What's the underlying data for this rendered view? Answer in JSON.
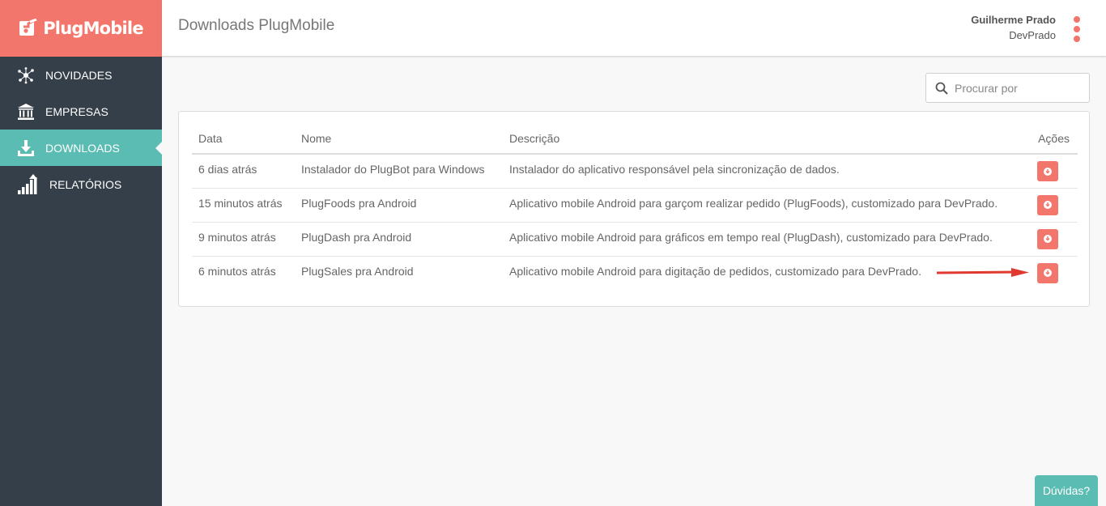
{
  "brand": {
    "name": "PlugMobile",
    "color": "#f2766b"
  },
  "header": {
    "title": "Downloads PlugMobile"
  },
  "user": {
    "name": "Guilherme Prado",
    "company": "DevPrado"
  },
  "sidebar": {
    "items": [
      {
        "label": "NOVIDADES",
        "icon": "network-icon",
        "active": false
      },
      {
        "label": "EMPRESAS",
        "icon": "bank-icon",
        "active": false
      },
      {
        "label": "DOWNLOADS",
        "icon": "download-icon",
        "active": true
      },
      {
        "label": "RELATÓRIOS",
        "icon": "bar-chart-icon",
        "active": false
      }
    ]
  },
  "search": {
    "placeholder": "Procurar por",
    "value": ""
  },
  "table": {
    "headers": {
      "date": "Data",
      "name": "Nome",
      "description": "Descrição",
      "actions": "Ações"
    },
    "rows": [
      {
        "date": "6 dias atrás",
        "name": "Instalador do PlugBot para Windows",
        "description": "Instalador do aplicativo responsável pela sincronização de dados."
      },
      {
        "date": "15 minutos atrás",
        "name": "PlugFoods pra Android",
        "description": "Aplicativo mobile Android para garçom realizar pedido (PlugFoods), customizado para DevPrado."
      },
      {
        "date": "9 minutos atrás",
        "name": "PlugDash pra Android",
        "description": "Aplicativo mobile Android para gráficos em tempo real (PlugDash), customizado para DevPrado."
      },
      {
        "date": "6 minutos atrás",
        "name": "PlugSales pra Android",
        "description": "Aplicativo mobile Android para digitação de pedidos, customizado para DevPrado."
      }
    ]
  },
  "help": {
    "label": "Dúvidas?"
  },
  "colors": {
    "accent": "#f2766b",
    "teal": "#5bbcb3",
    "sidebar": "#353f49",
    "annotation_arrow": "#e03a30"
  }
}
